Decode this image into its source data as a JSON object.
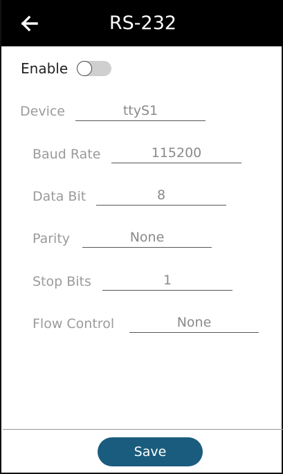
{
  "header": {
    "title": "RS-232",
    "back_icon": "arrow-left-icon"
  },
  "enable": {
    "label": "Enable",
    "on": false
  },
  "fields": {
    "device": {
      "label": "Device",
      "value": "ttyS1"
    },
    "baud_rate": {
      "label": "Baud Rate",
      "value": "115200"
    },
    "data_bit": {
      "label": "Data Bit",
      "value": "8"
    },
    "parity": {
      "label": "Parity",
      "value": "None"
    },
    "stop_bits": {
      "label": "Stop Bits",
      "value": "1"
    },
    "flow_control": {
      "label": "Flow Control",
      "value": "None"
    }
  },
  "footer": {
    "save_label": "Save"
  },
  "colors": {
    "header_bg": "#000000",
    "save_bg": "#1a5c7e",
    "toggle_track": "#cfcfcf"
  }
}
